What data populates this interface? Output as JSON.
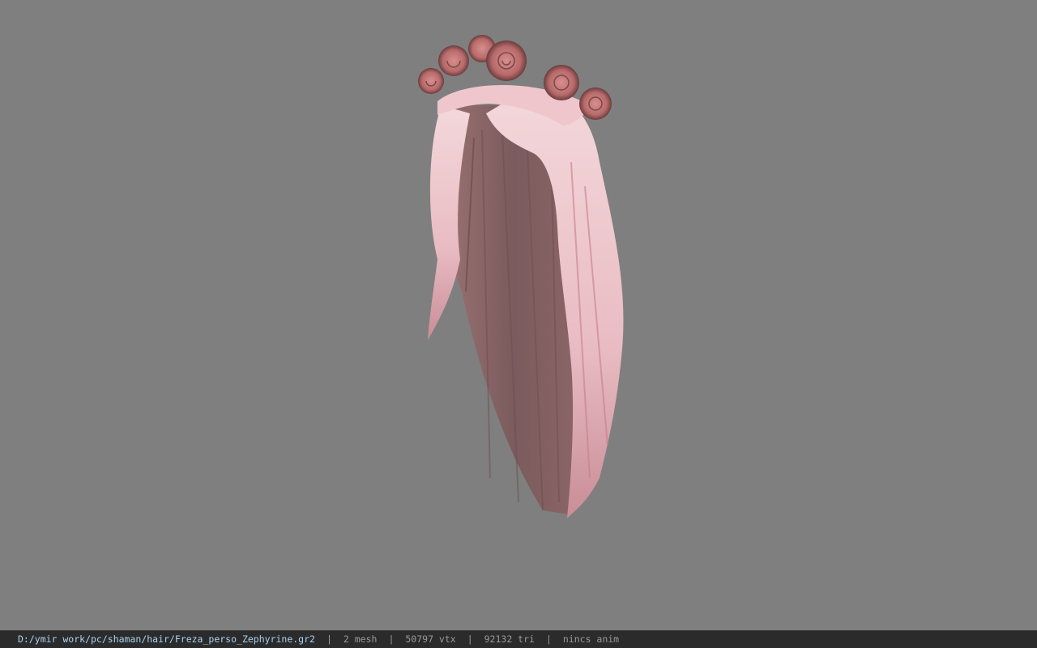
{
  "statusbar": {
    "file_path": "D:/ymir work/pc/shaman/hair/Freza_perso_Zephyrine.gr2",
    "mesh_count": "2 mesh",
    "vertex_count": "50797 vtx",
    "triangle_count": "92132 tri",
    "animation": "nincs anim",
    "separator": "|"
  },
  "colors": {
    "viewport_background": "#7f7f7f",
    "statusbar_background": "#2b2b2b",
    "path_text": "#a9d3f0",
    "stat_text": "#9a9a9a",
    "rose": "#b86a6a",
    "hair_light": "#f1d2d6",
    "hair_dark": "#8a5b5e"
  }
}
